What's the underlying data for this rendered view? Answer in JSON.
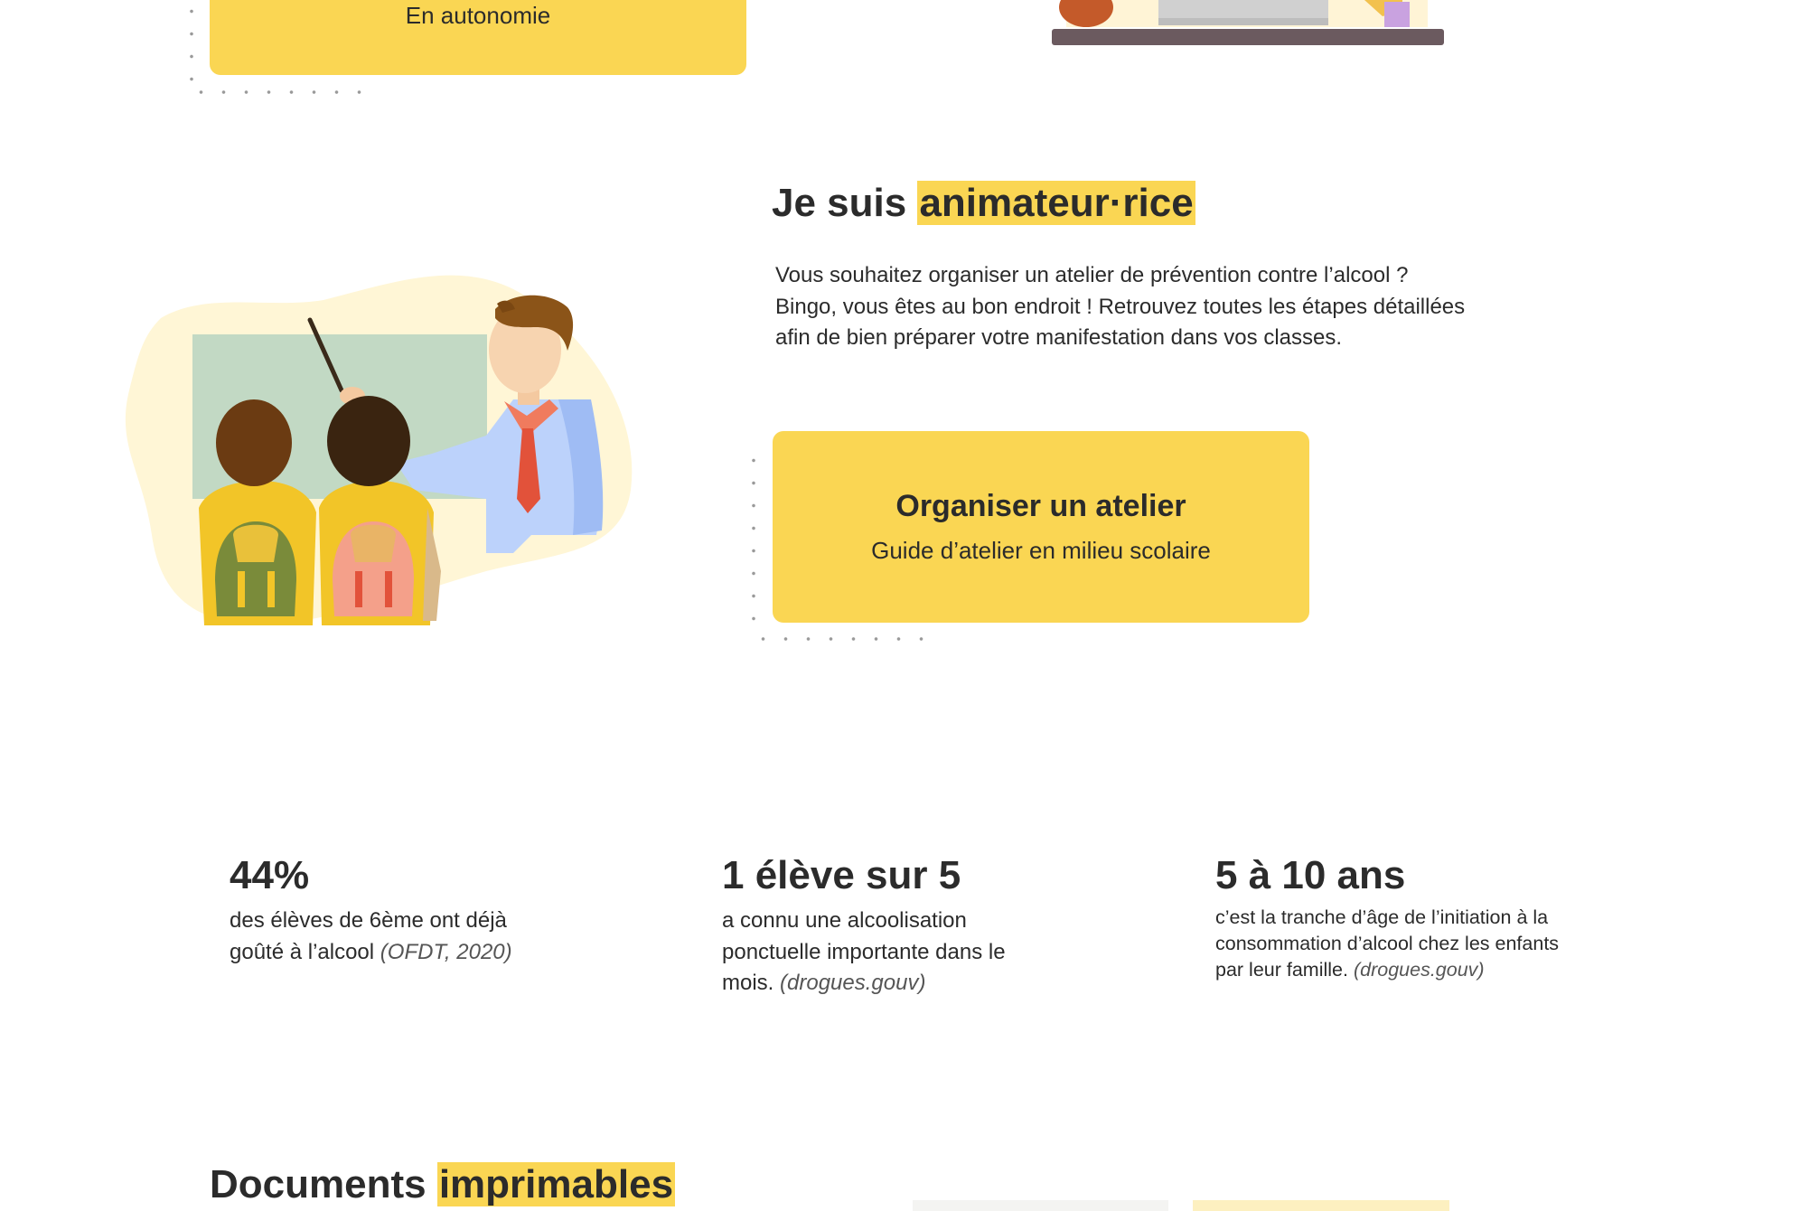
{
  "top_card": {
    "subtitle": "En autonomie"
  },
  "animateur": {
    "heading_prefix": "Je suis",
    "heading_highlight": "animateur·rice",
    "description": "Vous souhaitez organiser un atelier de prévention contre l’alcool ? Bingo, vous êtes au bon endroit ! Retrouvez toutes les étapes détaillées afin de bien préparer votre manifestation dans vos classes.",
    "cta_title": "Organiser un atelier",
    "cta_subtitle": "Guide d’atelier en milieu scolaire"
  },
  "stats": [
    {
      "value": "44%",
      "desc": "des élèves de 6ème ont déjà goûté à l’alcool",
      "source": "(OFDT, 2020)"
    },
    {
      "value": "1 élève sur 5",
      "desc": "a connu une alcoolisation ponctuelle importante dans le mois.",
      "source": "(drogues.gouv)"
    },
    {
      "value": "5 à 10 ans",
      "desc": "c’est la tranche d’âge de l’initiation à la consommation d’alcool chez les enfants par leur famille.",
      "source": "(drogues.gouv)"
    }
  ],
  "documents": {
    "heading_prefix": "Documents",
    "heading_highlight": "imprimables"
  },
  "colors": {
    "accent": "#fad653",
    "text": "#2b2b2b"
  }
}
